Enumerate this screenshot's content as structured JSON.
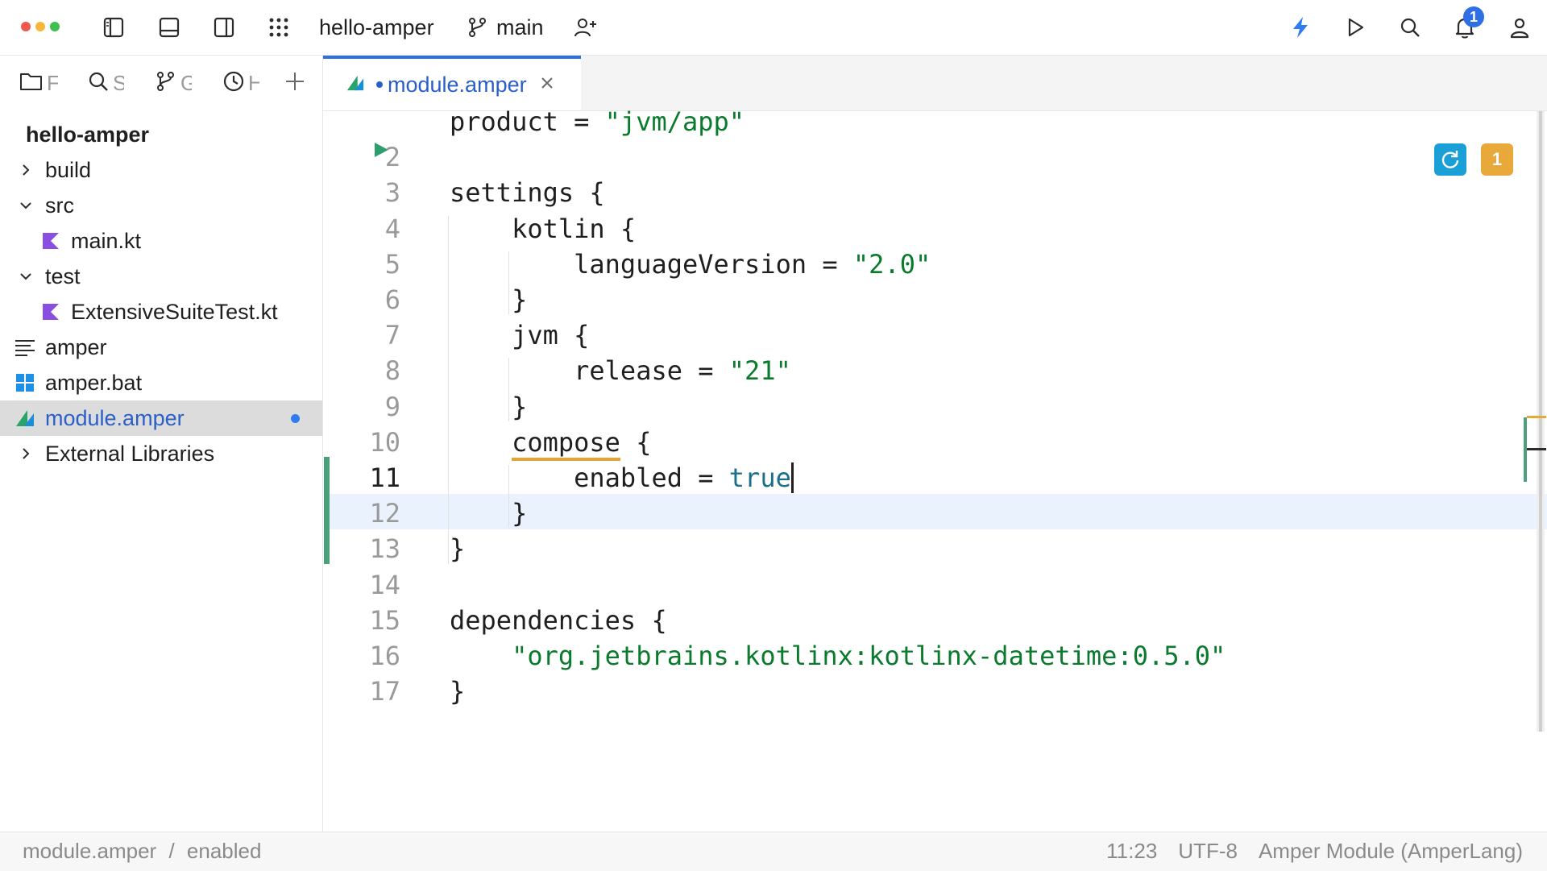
{
  "titlebar": {
    "project": "hello-amper",
    "branch": "main",
    "notification_count": "1",
    "traffic_colors": [
      "#f1584d",
      "#f6b73c",
      "#3fbf4d"
    ]
  },
  "left_panel": {
    "tool_tabs": [
      {
        "icon": "folder-icon",
        "label": "F"
      },
      {
        "icon": "search-icon",
        "label": "S"
      },
      {
        "icon": "git-branch-icon",
        "label": "G"
      },
      {
        "icon": "clock-icon",
        "label": "H"
      }
    ],
    "tree": {
      "root": "hello-amper",
      "items": [
        {
          "label": "build",
          "icon": "chevron-right-icon"
        },
        {
          "label": "src",
          "icon": "chevron-down-icon"
        },
        {
          "label": "main.kt",
          "icon": "kotlin-file-icon"
        },
        {
          "label": "test",
          "icon": "chevron-down-icon"
        },
        {
          "label": "ExtensiveSuiteTest.kt",
          "icon": "kotlin-file-icon"
        },
        {
          "label": "amper",
          "icon": "text-file-icon"
        },
        {
          "label": "amper.bat",
          "icon": "windows-file-icon"
        },
        {
          "label": "module.amper",
          "icon": "amper-file-icon"
        },
        {
          "label": "External Libraries",
          "icon": "chevron-right-icon"
        }
      ]
    }
  },
  "editor": {
    "tab_name": "module.amper",
    "reload_badge_color": "#1a9fd6",
    "warning_count": "1",
    "warning_color": "#e8a93a",
    "lines": [
      {
        "n": "",
        "segments": [
          {
            "t": "product = ",
            "c": "plain"
          },
          {
            "t": "\"jvm/app\"",
            "c": "str"
          }
        ]
      },
      {
        "n": "2",
        "segments": []
      },
      {
        "n": "3",
        "segments": [
          {
            "t": "settings {",
            "c": "plain"
          }
        ]
      },
      {
        "n": "4",
        "segments": [
          {
            "t": "    kotlin {",
            "c": "plain"
          }
        ]
      },
      {
        "n": "5",
        "segments": [
          {
            "t": "        languageVersion = ",
            "c": "plain"
          },
          {
            "t": "\"2.0\"",
            "c": "str"
          }
        ]
      },
      {
        "n": "6",
        "segments": [
          {
            "t": "    }",
            "c": "plain"
          }
        ]
      },
      {
        "n": "7",
        "segments": [
          {
            "t": "    jvm {",
            "c": "plain"
          }
        ]
      },
      {
        "n": "8",
        "segments": [
          {
            "t": "        release = ",
            "c": "plain"
          },
          {
            "t": "\"21\"",
            "c": "str"
          }
        ]
      },
      {
        "n": "9",
        "segments": [
          {
            "t": "    }",
            "c": "plain"
          }
        ]
      },
      {
        "n": "10",
        "segments": [
          {
            "t": "    ",
            "c": "plain"
          },
          {
            "t": "compose",
            "c": "warn"
          },
          {
            "t": " {",
            "c": "plain"
          }
        ]
      },
      {
        "n": "11",
        "segments": [
          {
            "t": "        enabled = ",
            "c": "plain"
          },
          {
            "t": "true",
            "c": "kw"
          }
        ]
      },
      {
        "n": "12",
        "segments": [
          {
            "t": "    }",
            "c": "plain"
          }
        ]
      },
      {
        "n": "13",
        "segments": [
          {
            "t": "}",
            "c": "plain"
          }
        ]
      },
      {
        "n": "14",
        "segments": []
      },
      {
        "n": "15",
        "segments": [
          {
            "t": "dependencies {",
            "c": "plain"
          }
        ]
      },
      {
        "n": "16",
        "segments": [
          {
            "t": "    ",
            "c": "plain"
          },
          {
            "t": "\"org.jetbrains.kotlinx:kotlinx-datetime:0.5.0\"",
            "c": "str"
          }
        ]
      },
      {
        "n": "17",
        "segments": [
          {
            "t": "}",
            "c": "plain"
          }
        ]
      }
    ],
    "active_line": "11"
  },
  "statusbar": {
    "breadcrumb_file": "module.amper",
    "breadcrumb_sep": "/",
    "breadcrumb_item": "enabled",
    "position": "11:23",
    "encoding": "UTF-8",
    "language": "Amper Module (AmperLang)"
  }
}
